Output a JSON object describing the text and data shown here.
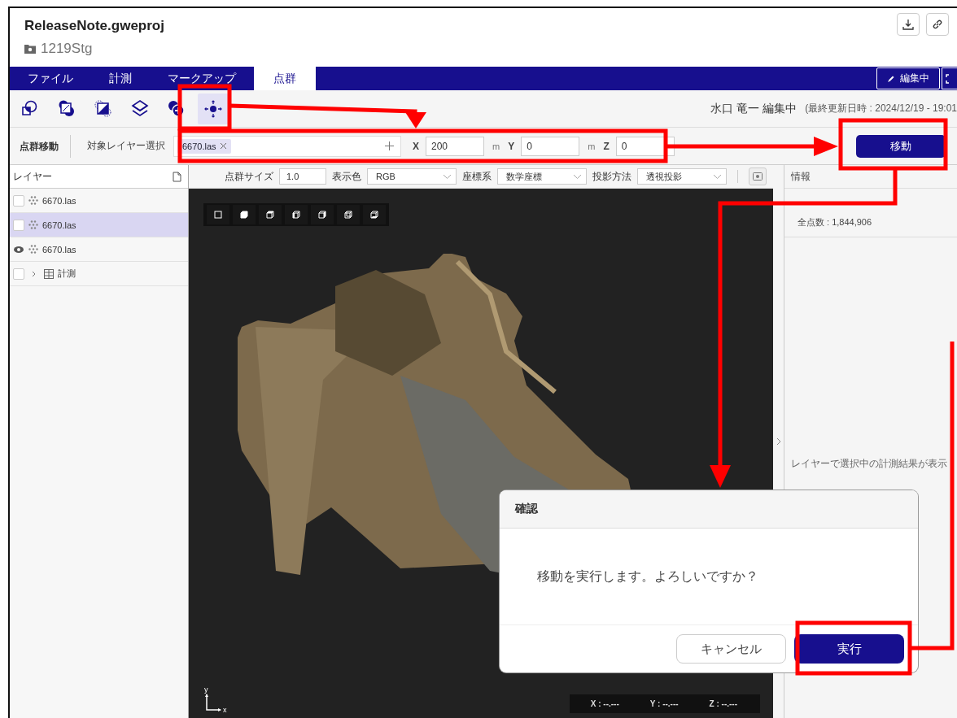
{
  "document": {
    "title": "ReleaseNote.gweproj",
    "folder": "1219Stg"
  },
  "menu_tabs": [
    {
      "label": "ファイル",
      "selected": false
    },
    {
      "label": "計測",
      "selected": false
    },
    {
      "label": "マークアップ",
      "selected": false
    },
    {
      "label": "点群",
      "selected": true
    }
  ],
  "edit_button": {
    "label": "編集中"
  },
  "tools": [
    {
      "kind": "union",
      "selected": false
    },
    {
      "kind": "intersect",
      "selected": false
    },
    {
      "kind": "subtract",
      "selected": false
    },
    {
      "kind": "layers",
      "selected": false
    },
    {
      "kind": "add",
      "selected": false
    },
    {
      "kind": "move",
      "selected": true
    }
  ],
  "status": {
    "editor": "水口 竜一 編集中",
    "updated": "(最終更新日時 : 2024/12/19 - 19:01"
  },
  "move_bar": {
    "title": "点群移動",
    "target_label": "対象レイヤー選択",
    "chips": [
      "6670.las"
    ],
    "axes": [
      {
        "label": "X",
        "value": "200",
        "unit": "m"
      },
      {
        "label": "Y",
        "value": "0",
        "unit": "m"
      },
      {
        "label": "Z",
        "value": "0"
      }
    ],
    "button": "移動"
  },
  "layers": {
    "title": "レイヤー",
    "items": [
      {
        "kind": "pointcloud",
        "name": "6670.las",
        "visible": false,
        "selected": false
      },
      {
        "kind": "pointcloud",
        "name": "6670.las",
        "visible": false,
        "selected": true
      },
      {
        "kind": "pointcloud",
        "name": "6670.las",
        "visible": true,
        "selected": false
      },
      {
        "kind": "group",
        "name": "計測",
        "visible": false,
        "selected": false,
        "expanded": false
      }
    ]
  },
  "viewer": {
    "controls": [
      {
        "kind": "input",
        "label": "点群サイズ",
        "value": "1.0"
      },
      {
        "kind": "select",
        "label": "表示色",
        "value": "RGB"
      },
      {
        "kind": "select",
        "label": "座標系",
        "value": "数学座標"
      },
      {
        "kind": "select",
        "label": "投影方法",
        "value": "透視投影"
      }
    ],
    "view_buttons": [
      {
        "kind": "frame"
      },
      {
        "kind": "solid"
      },
      {
        "kind": "top"
      },
      {
        "kind": "left"
      },
      {
        "kind": "right"
      },
      {
        "kind": "back"
      },
      {
        "kind": "bottom"
      }
    ],
    "axis_labels": [
      "x",
      "y"
    ],
    "coords": [
      "X : --.---",
      "Y : --.---",
      "Z : --.---"
    ]
  },
  "info": {
    "title": "情報",
    "points": "全点数 : 1,844,906",
    "message": "レイヤーで選択中の計測結果が表示"
  },
  "dialog": {
    "title": "確認",
    "message": "移動を実行します。よろしいですか？",
    "buttons": [
      {
        "kind": "secondary",
        "label": "キャンセル"
      },
      {
        "kind": "primary",
        "label": "実行"
      }
    ]
  }
}
